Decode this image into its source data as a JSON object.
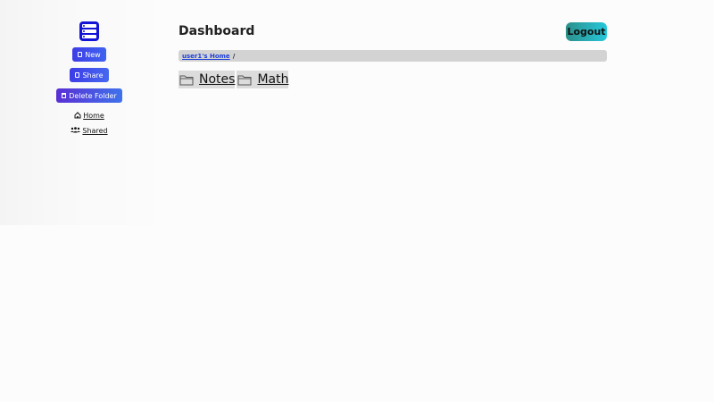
{
  "sidebar": {
    "new_label": "New",
    "share_label": "Share",
    "delete_label": "Delete Folder",
    "home_label": "Home",
    "shared_label": "Shared"
  },
  "header": {
    "title": "Dashboard",
    "logout_label": "Logout"
  },
  "breadcrumb": {
    "home_link": "user1's Home",
    "separator": "/"
  },
  "folders": [
    {
      "name": "Notes",
      "icon": "folder-icon"
    },
    {
      "name": "Math",
      "icon": "folder-icon"
    }
  ],
  "colors": {
    "accent_blue": "#3d3de6",
    "logo": "#1414d6",
    "logout_start": "#2c8f8a",
    "logout_end": "#25c8dc",
    "breadcrumb_bg": "#d3d3d3",
    "link": "#1e3fd8"
  }
}
